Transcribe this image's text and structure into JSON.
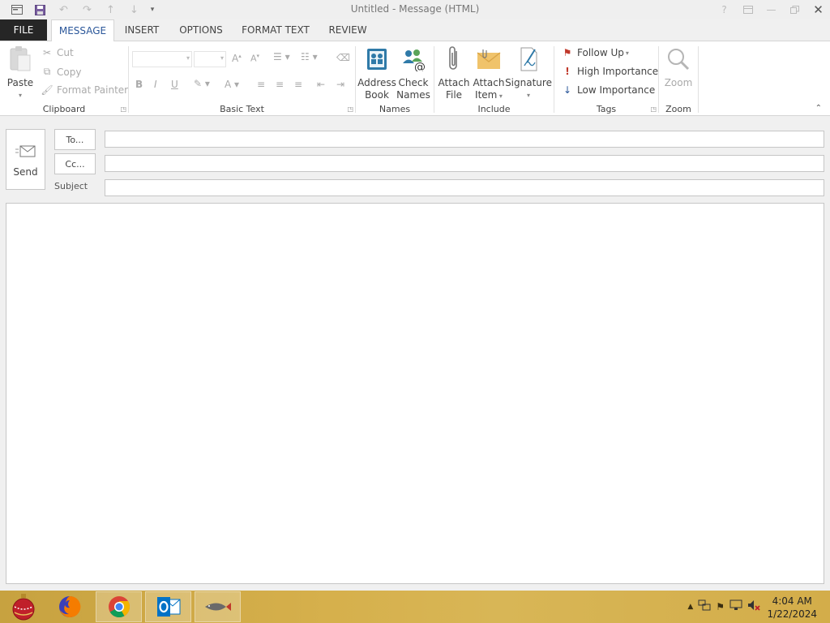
{
  "window": {
    "title": "Untitled - Message (HTML)"
  },
  "qat": {
    "icons": [
      "outlook-window-icon",
      "save-icon",
      "undo-icon",
      "redo-icon",
      "up-arrow-icon",
      "down-arrow-icon",
      "customize-icon"
    ]
  },
  "tabs": {
    "file": "FILE",
    "message": "MESSAGE",
    "insert": "INSERT",
    "options": "OPTIONS",
    "format_text": "FORMAT TEXT",
    "review": "REVIEW"
  },
  "ribbon": {
    "clipboard": {
      "label": "Clipboard",
      "paste": "Paste",
      "cut": "Cut",
      "copy": "Copy",
      "format_painter": "Format Painter"
    },
    "basic_text": {
      "label": "Basic Text",
      "bold": "B",
      "italic": "I",
      "underline": "U",
      "font_color": "A"
    },
    "names": {
      "label": "Names",
      "address_book_1": "Address",
      "address_book_2": "Book",
      "check_names_1": "Check",
      "check_names_2": "Names"
    },
    "include": {
      "label": "Include",
      "attach_file_1": "Attach",
      "attach_file_2": "File",
      "attach_item_1": "Attach",
      "attach_item_2": "Item",
      "signature": "Signature"
    },
    "tags": {
      "label": "Tags",
      "follow_up": "Follow Up",
      "high_importance": "High Importance",
      "low_importance": "Low Importance"
    },
    "zoom": {
      "label": "Zoom",
      "zoom": "Zoom"
    }
  },
  "compose": {
    "send": "Send",
    "to": "To...",
    "cc": "Cc...",
    "subject_label": "Subject",
    "to_value": "",
    "cc_value": "",
    "subject_value": ""
  },
  "taskbar": {
    "apps": [
      "start-ornament-icon",
      "firefox-icon",
      "chrome-icon",
      "outlook-icon",
      "fish-app-icon"
    ],
    "time": "4:04 AM",
    "date": "1/22/2024"
  },
  "colors": {
    "file_tab": "#262626",
    "active_tab_text": "#2b579a",
    "taskbar": "#d6b04c",
    "follow_up_flag": "#c0392b",
    "high_importance": "#c0392b",
    "low_importance": "#2b579a"
  }
}
